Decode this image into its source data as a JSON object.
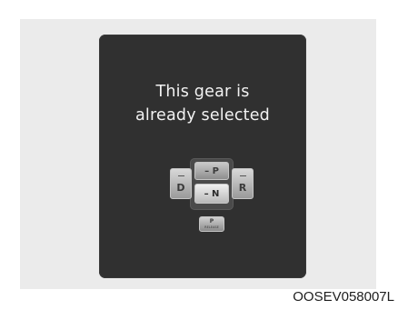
{
  "display": {
    "message_line1": "This gear is",
    "message_line2": "already selected"
  },
  "shifter": {
    "d_label": "D",
    "r_label": "R",
    "p_label": "– P",
    "n_label": "– N",
    "park_label": "P",
    "park_sublabel": "RELEASE"
  },
  "figure_code": "OOSEV058007L",
  "colors": {
    "panel_background": "#ebebeb",
    "display_background": "#303030",
    "message_text": "#f2f2f2"
  }
}
